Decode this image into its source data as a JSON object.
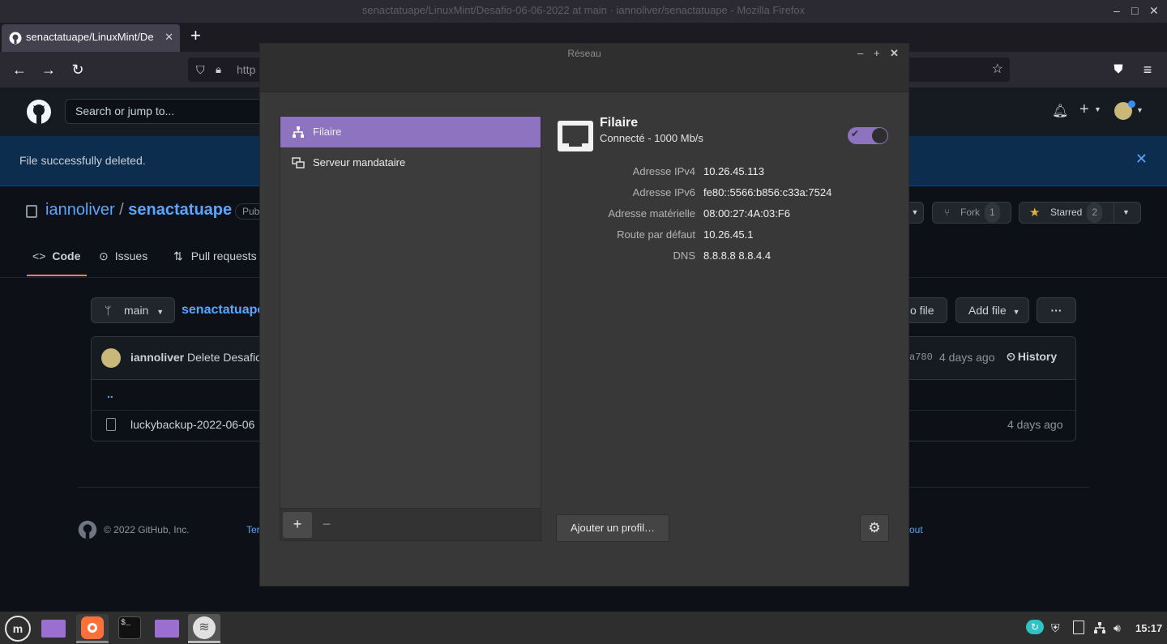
{
  "firefox": {
    "window_title": "senactatuape/LinuxMint/Desafio-06-06-2022 at main · iannoliver/senactatuape - Mozilla Firefox",
    "tab_title": "senactatuape/LinuxMint/De",
    "url_placeholder": "http",
    "min": "–",
    "max": "□",
    "close": "✕"
  },
  "github": {
    "search_placeholder": "Search or jump to...",
    "flash_message": "File successfully deleted.",
    "owner": "iannoliver",
    "separator": "/",
    "repo": "senactatuape",
    "visibility": "Pub",
    "fork_label": "Fork",
    "fork_count": "1",
    "starred_label": "Starred",
    "star_count": "2",
    "tabs": [
      {
        "label": "Code"
      },
      {
        "label": "Issues"
      },
      {
        "label": "Pull requests"
      }
    ],
    "branch": "main",
    "breadcrumb_repo": "senactatuape",
    "go_to_file": "o file",
    "add_file": "Add file",
    "more": "···",
    "commit": {
      "author": "iannoliver",
      "message": "Delete Desafio",
      "sha": "a780",
      "time": "4 days ago",
      "history": "History"
    },
    "parent_dir": "..",
    "files": [
      {
        "name": "luckybackup-2022-06-06",
        "time": "4 days ago"
      }
    ],
    "footer_copyright": "© 2022 GitHub, Inc.",
    "footer_link_left": "Ter",
    "footer_link_right": "out"
  },
  "dialog": {
    "title": "Réseau",
    "sidebar_items": [
      {
        "label": "Filaire",
        "selected": true
      },
      {
        "label": "Serveur mandataire",
        "selected": false
      }
    ],
    "add_button": "+",
    "remove_button": "−",
    "connection": {
      "name": "Filaire",
      "status": "Connecté - 1000 Mb/s",
      "enabled": true
    },
    "details": [
      {
        "label": "Adresse IPv4",
        "value": "10.26.45.113"
      },
      {
        "label": "Adresse IPv6",
        "value": "fe80::5566:b856:c33a:7524"
      },
      {
        "label": "Adresse matérielle",
        "value": "08:00:27:4A:03:F6"
      },
      {
        "label": "Route par défaut",
        "value": "10.26.45.1"
      },
      {
        "label": "DNS",
        "value": "8.8.8.8 8.8.4.4"
      }
    ],
    "add_profile_button": "Ajouter un profil…",
    "accent_color": "#8e73c1"
  },
  "taskbar": {
    "clock": "15:17"
  }
}
